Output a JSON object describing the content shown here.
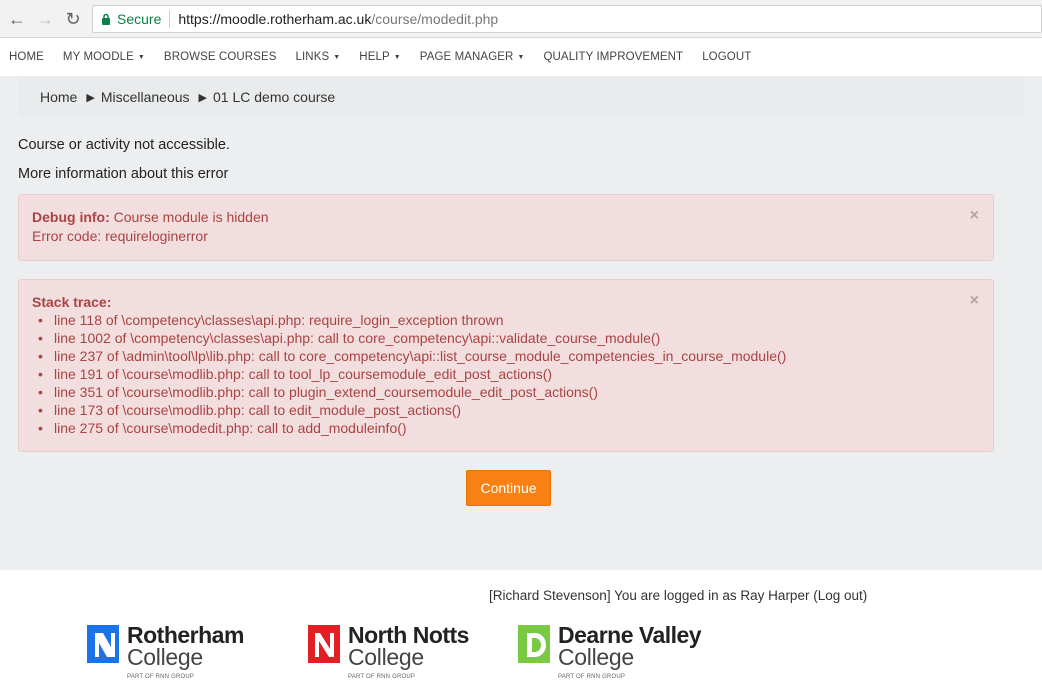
{
  "browser": {
    "secure_label": "Secure",
    "url_host": "https://moodle.rotherham.ac.uk",
    "url_path": "/course/modedit.php"
  },
  "nav": {
    "items": [
      {
        "label": "HOME",
        "dropdown": false
      },
      {
        "label": "MY MOODLE",
        "dropdown": true
      },
      {
        "label": "BROWSE COURSES",
        "dropdown": false
      },
      {
        "label": "LINKS",
        "dropdown": true
      },
      {
        "label": "HELP",
        "dropdown": true
      },
      {
        "label": "PAGE MANAGER",
        "dropdown": true
      },
      {
        "label": "QUALITY IMPROVEMENT",
        "dropdown": false
      },
      {
        "label": "LOGOUT",
        "dropdown": false
      }
    ]
  },
  "breadcrumb": {
    "home": "Home",
    "category": "Miscellaneous",
    "course": "01 LC demo course"
  },
  "messages": {
    "error": "Course or activity not accessible.",
    "more_info": "More information about this error"
  },
  "debug": {
    "label": "Debug info:",
    "text": "Course module is hidden",
    "error_code": "Error code: requireloginerror"
  },
  "stack": {
    "label": "Stack trace:",
    "lines": [
      "line 118 of \\competency\\classes\\api.php: require_login_exception thrown",
      "line 1002 of \\competency\\classes\\api.php: call to core_competency\\api::validate_course_module()",
      "line 237 of \\admin\\tool\\lp\\lib.php: call to core_competency\\api::list_course_module_competencies_in_course_module()",
      "line 191 of \\course\\modlib.php: call to tool_lp_coursemodule_edit_post_actions()",
      "line 351 of \\course\\modlib.php: call to plugin_extend_coursemodule_edit_post_actions()",
      "line 173 of \\course\\modlib.php: call to edit_module_post_actions()",
      "line 275 of \\course\\modedit.php: call to add_moduleinfo()"
    ]
  },
  "continue_label": "Continue",
  "footer": {
    "login_info": "[Richard Stevenson] You are logged in as Ray Harper (Log out)",
    "logos": [
      {
        "line1": "Rotherham",
        "line2": "College",
        "tag": "PART OF RNN GROUP",
        "color": "#1a73e8"
      },
      {
        "line1": "North Notts",
        "line2": "College",
        "tag": "PART OF RNN GROUP",
        "color": "#e31e24"
      },
      {
        "line1": "Dearne Valley",
        "line2": "College",
        "tag": "PART OF RNN GROUP",
        "color": "#7ac943"
      }
    ]
  },
  "colors": {
    "accent": "#f98012",
    "alert_bg": "#f2dede",
    "alert_text": "#a94442"
  }
}
